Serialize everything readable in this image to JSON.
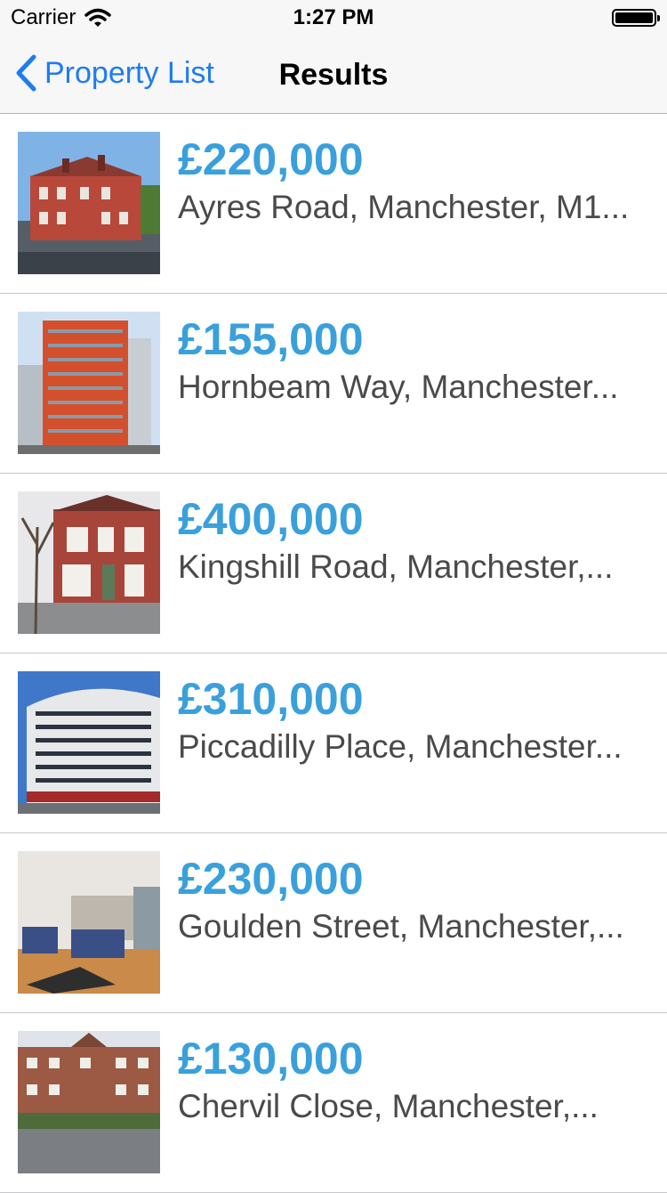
{
  "status_bar": {
    "carrier": "Carrier",
    "time": "1:27 PM",
    "icons": [
      "wifi-icon",
      "battery-icon"
    ]
  },
  "nav_bar": {
    "back_label": "Property List",
    "title": "Results",
    "accent_color": "#1e7cf2"
  },
  "price_color": "#3aa0dc",
  "listings": [
    {
      "price": "£220,000",
      "address": "Ayres Road, Manchester, M1...",
      "thumbnail": "red-brick-house-photo"
    },
    {
      "price": "£155,000",
      "address": "Hornbeam Way,  Manchester...",
      "thumbnail": "orange-apartment-tower-photo"
    },
    {
      "price": "£400,000",
      "address": "Kingshill Road, Manchester,...",
      "thumbnail": "terraced-house-photo"
    },
    {
      "price": "£310,000",
      "address": "Piccadilly Place, Manchester...",
      "thumbnail": "curved-apartment-block-photo"
    },
    {
      "price": "£230,000",
      "address": "Goulden Street, Manchester,...",
      "thumbnail": "living-room-interior-photo"
    },
    {
      "price": "£130,000",
      "address": "Chervil Close, Manchester,...",
      "thumbnail": "brick-apartment-building-photo"
    }
  ]
}
